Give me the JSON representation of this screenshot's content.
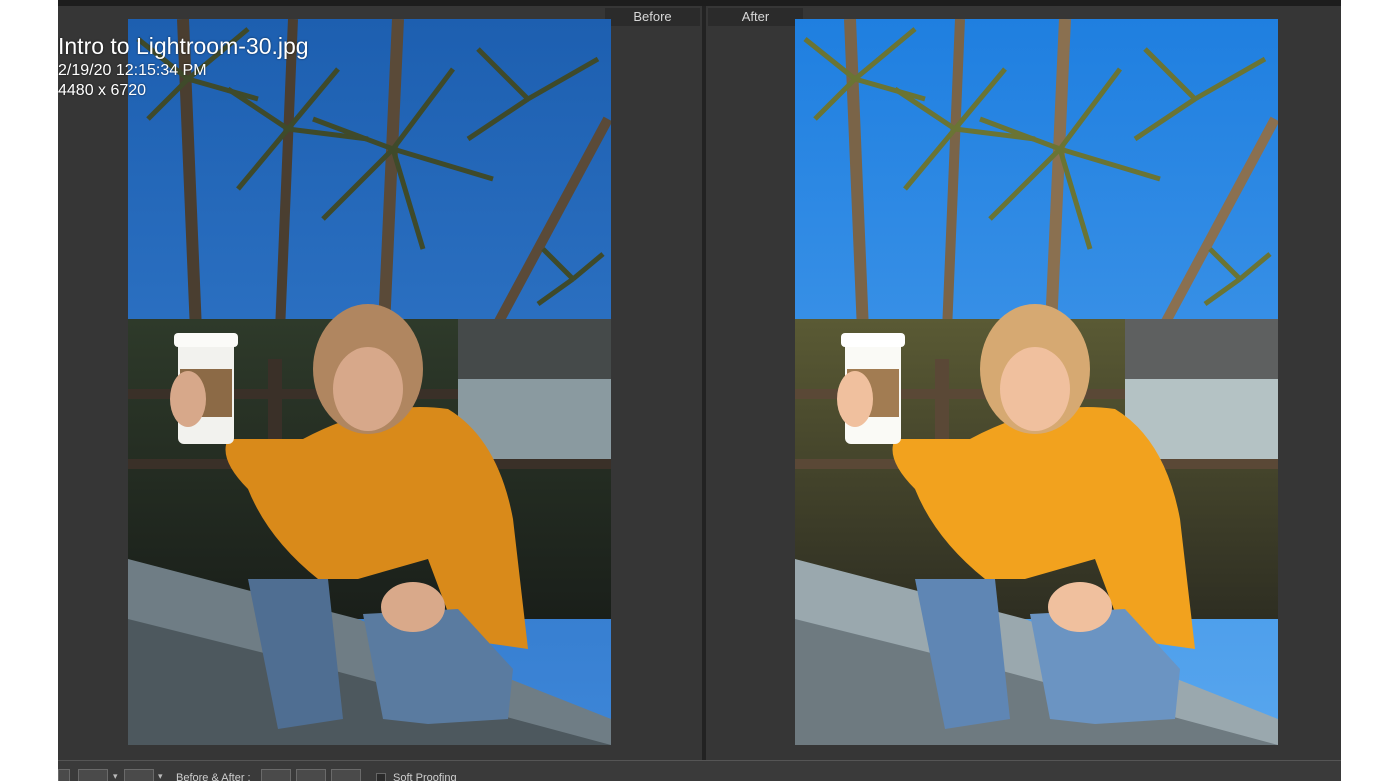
{
  "info": {
    "filename": "Intro to Lightroom-30.jpg",
    "datetime": "2/19/20 12:15:34 PM",
    "dimensions": "4480 x 6720"
  },
  "panes": {
    "before_label": "Before",
    "after_label": "After"
  },
  "toolbar": {
    "before_after_label": "Before & After :",
    "soft_proofing_label": "Soft Proofing",
    "view_icons": [
      "loupe-view-icon",
      "compare-view-icon",
      "before-after-view-icon"
    ],
    "swap_icons": [
      "copy-before-to-after-icon",
      "copy-after-to-before-icon",
      "swap-before-after-icon"
    ]
  },
  "colors": {
    "app_background": "#2f2f2f",
    "pane_background": "#363636",
    "label_background": "#2b2b2b"
  }
}
